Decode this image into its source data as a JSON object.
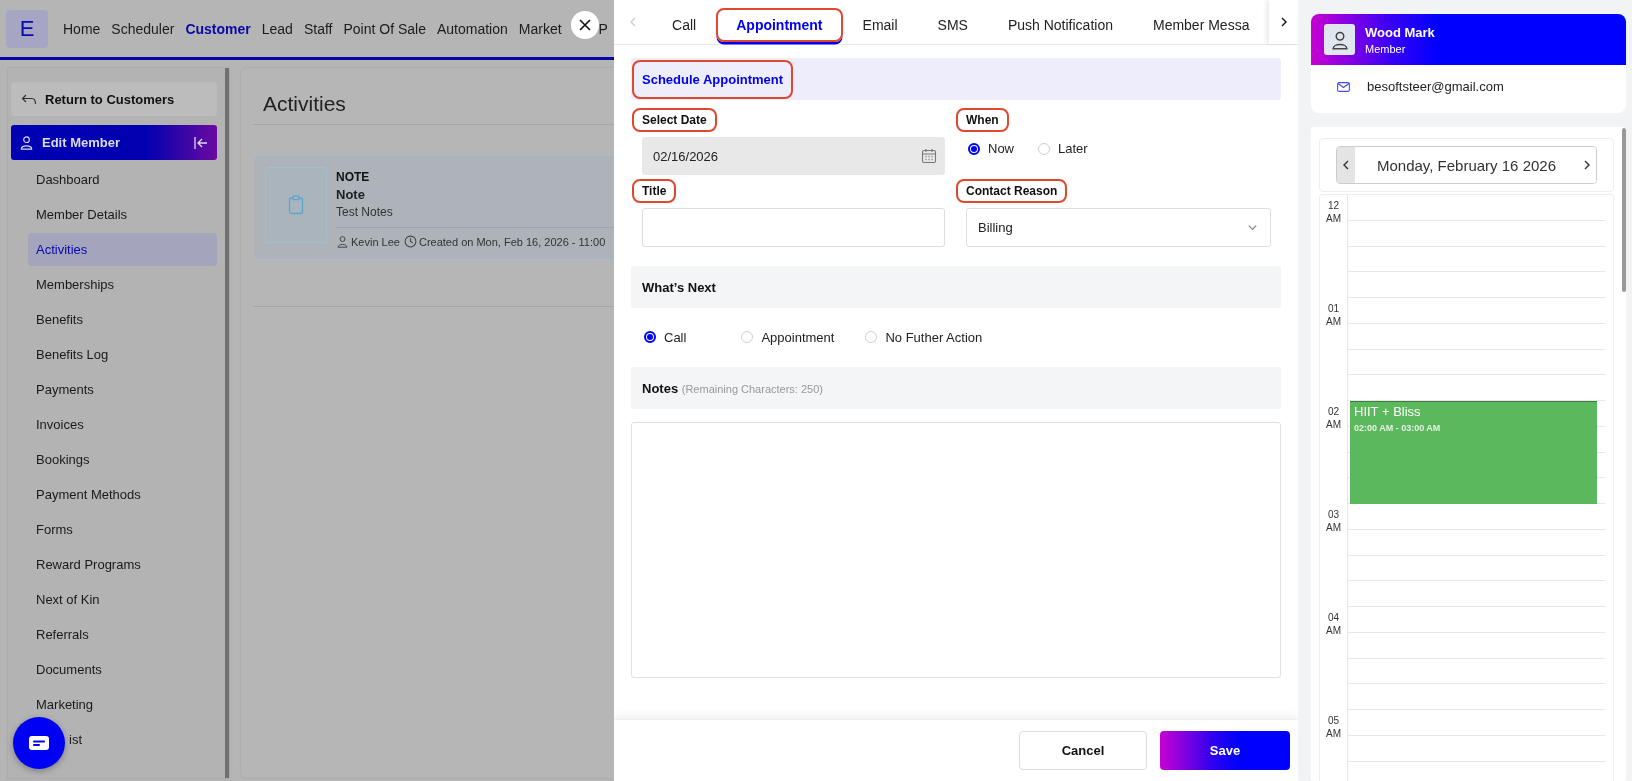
{
  "top_nav": {
    "logo": "E",
    "items": [
      {
        "label": "Home",
        "selected": false
      },
      {
        "label": "Scheduler",
        "selected": false
      },
      {
        "label": "Customer",
        "selected": true
      },
      {
        "label": "Lead",
        "selected": false
      },
      {
        "label": "Staff",
        "selected": false
      },
      {
        "label": "Point Of Sale",
        "selected": false
      },
      {
        "label": "Automation",
        "selected": false
      },
      {
        "label": "Market",
        "selected": false
      },
      {
        "label": "P",
        "selected": false
      }
    ]
  },
  "sidebar": {
    "back_button": "Return to Customers",
    "section": "Edit Member",
    "items": [
      {
        "label": "Dashboard",
        "selected": false,
        "kind": "item"
      },
      {
        "label": "Member Details",
        "selected": false,
        "kind": "item"
      },
      {
        "label": "Activities",
        "selected": true,
        "kind": "item"
      },
      {
        "label": "Memberships",
        "selected": false,
        "kind": "item"
      },
      {
        "label": "Benefits",
        "selected": false,
        "kind": "item"
      },
      {
        "label": "Benefits Log",
        "selected": false,
        "kind": "item"
      },
      {
        "label": "Payments",
        "selected": false,
        "kind": "item"
      },
      {
        "label": "Invoices",
        "selected": false,
        "kind": "item"
      },
      {
        "label": "Bookings",
        "selected": false,
        "kind": "item"
      },
      {
        "label": "Payment Methods",
        "selected": false,
        "kind": "item"
      },
      {
        "label": "Forms",
        "selected": false,
        "kind": "item"
      },
      {
        "label": "Reward Programs",
        "selected": false,
        "kind": "item"
      },
      {
        "label": "Next of Kin",
        "selected": false,
        "kind": "item"
      },
      {
        "label": "Referrals",
        "selected": false,
        "kind": "item"
      },
      {
        "label": "Documents",
        "selected": false,
        "kind": "item"
      },
      {
        "label": "Marketing",
        "selected": false,
        "kind": "item"
      },
      {
        "label": "ist",
        "selected": false,
        "kind": "covered"
      }
    ]
  },
  "main": {
    "title": "Activities",
    "activities": [
      {
        "type": "NOTE",
        "title": "Note",
        "text": "Test Notes",
        "author": "Kevin Lee",
        "created": "Created on Mon, Feb 16, 2026 - 11:00"
      }
    ]
  },
  "modal": {
    "tabs": [
      {
        "label": "Call",
        "selected": false,
        "highlighted": false
      },
      {
        "label": "Appointment",
        "selected": true,
        "highlighted": true
      },
      {
        "label": "Email",
        "selected": false,
        "highlighted": false
      },
      {
        "label": "SMS",
        "selected": false,
        "highlighted": false
      },
      {
        "label": "Push Notification",
        "selected": false,
        "highlighted": false
      },
      {
        "label": "Member Messa",
        "selected": false,
        "highlighted": false
      }
    ],
    "section_title": {
      "text": "Schedule Appointment",
      "highlighted": true
    },
    "date": {
      "label": "Select Date",
      "highlighted": true,
      "value": "02/16/2026"
    },
    "when": {
      "label": "When",
      "highlighted": true,
      "options": [
        {
          "label": "Now",
          "selected": true
        },
        {
          "label": "Later",
          "selected": false
        }
      ]
    },
    "title_field": {
      "label": "Title",
      "highlighted": true
    },
    "contact_reason": {
      "label": "Contact Reason",
      "highlighted": true,
      "value": "Billing"
    },
    "whats_next": {
      "title": "What’s Next",
      "options": [
        {
          "label": "Call",
          "selected": true
        },
        {
          "label": "Appointment",
          "selected": false
        },
        {
          "label": "No Futher Action",
          "selected": false
        }
      ]
    },
    "notes": {
      "title": "Notes",
      "hint": "(Remaining Characters: 250)"
    },
    "buttons": [
      {
        "label": "Cancel",
        "kind": "secondary"
      },
      {
        "label": "Save",
        "kind": "primary"
      }
    ]
  },
  "member": {
    "name": "Wood Mark",
    "role": "Member",
    "email": "besoftsteer@gmail.com"
  },
  "calendar": {
    "date": "Monday, February 16 2026",
    "hours": [
      {
        "label": "12 AM"
      },
      {
        "label": "01 AM"
      },
      {
        "label": "02 AM",
        "events": [
          {
            "title": "HIIT + Bliss",
            "time": "02:00 AM - 03:00 AM"
          }
        ]
      },
      {
        "label": "03 AM"
      },
      {
        "label": "04 AM"
      },
      {
        "label": "05 AM"
      }
    ]
  }
}
